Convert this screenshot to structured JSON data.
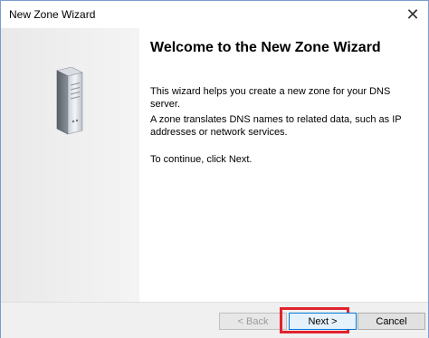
{
  "window": {
    "title": "New Zone Wizard"
  },
  "icons": {
    "close": "close-icon",
    "server": "server-icon"
  },
  "content": {
    "heading": "Welcome to the New Zone Wizard",
    "paragraphs": [
      "This wizard helps you create a new zone for your DNS server.",
      "A zone translates DNS names to related data, such as IP addresses or network services.",
      "To continue, click Next."
    ]
  },
  "footer": {
    "back_label": "< Back",
    "next_label": "Next >",
    "cancel_label": "Cancel"
  },
  "colors": {
    "highlight": "#e0232e",
    "focus_border": "#0078d7"
  }
}
